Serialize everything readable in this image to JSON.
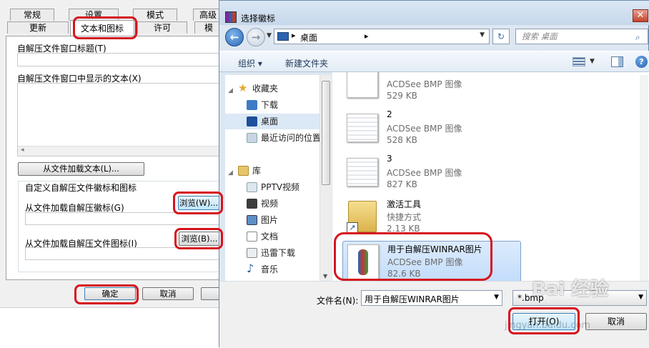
{
  "winrar": {
    "tabs_row1": [
      "常规",
      "设置",
      "模式",
      "高级"
    ],
    "tabs_row2": [
      "更新",
      "文本和图标",
      "许可",
      "模"
    ],
    "title_label": "自解压文件窗口标题(T)",
    "text_label": "自解压文件窗口中显示的文本(X)",
    "load_text_button": "从文件加载文本(L)...",
    "group_title": "自定义自解压文件徽标和图标",
    "logo_label": "从文件加载自解压徽标(G)",
    "icon_label": "从文件加载自解压文件图标(I)",
    "browse_w": "浏览(W)...",
    "browse_b": "浏览(B)...",
    "ok": "确定",
    "cancel": "取消"
  },
  "dialog": {
    "title": "选择徽标",
    "address": "桌面",
    "search_placeholder": "搜索 桌面",
    "organize": "组织 ▾",
    "new_folder": "新建文件夹",
    "nav": {
      "favorites": "收藏夹",
      "downloads": "下载",
      "desktop": "桌面",
      "recent": "最近访问的位置",
      "library": "库",
      "pptv": "PPTV视频",
      "video": "视频",
      "pictures": "图片",
      "documents": "文档",
      "thunder": "迅雷下载",
      "music": "音乐"
    },
    "files": [
      {
        "name": "",
        "type": "ACDSee BMP 图像",
        "size": "529 KB"
      },
      {
        "name": "2",
        "type": "ACDSee BMP 图像",
        "size": "528 KB"
      },
      {
        "name": "3",
        "type": "ACDSee BMP 图像",
        "size": "827 KB"
      },
      {
        "name": "激活工具",
        "type": "快捷方式",
        "size": "2.13 KB"
      },
      {
        "name": "用于自解压WINRAR图片",
        "type": "ACDSee BMP 图像",
        "size": "82.6 KB"
      }
    ],
    "filename_label": "文件名(N):",
    "filename_value": "用于自解压WINRAR图片",
    "filter_value": "*.bmp",
    "open": "打开(O)",
    "cancel": "取消"
  },
  "watermark": "Bai 经验",
  "watermark_url": "jingyan.baidu.com",
  "colors": {
    "highlight_ring": "#d6141d",
    "accent": "#3c7fb1"
  }
}
